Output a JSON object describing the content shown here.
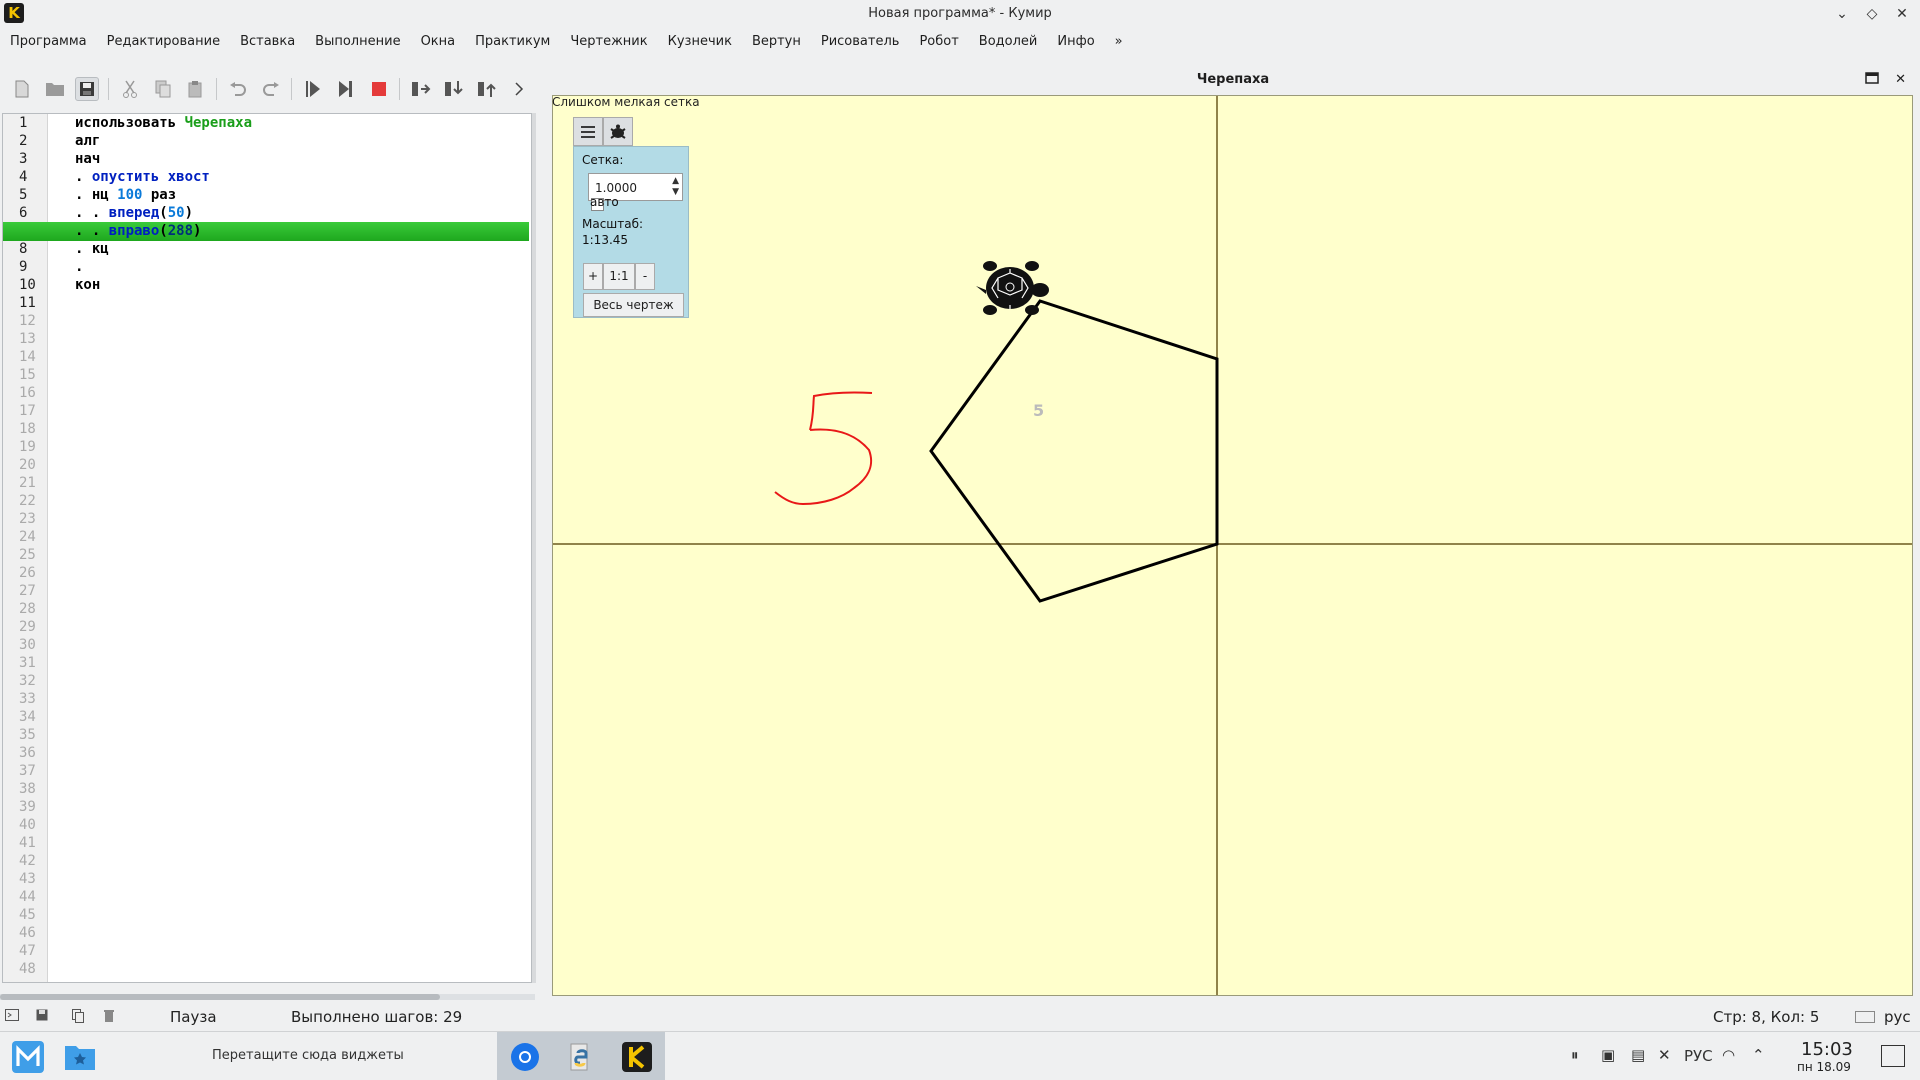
{
  "window": {
    "title": "Новая программа* - Кумир",
    "logo_letter": "K",
    "controls": [
      "⌄",
      "◇",
      "✕"
    ]
  },
  "menu": [
    "Программа",
    "Редактирование",
    "Вставка",
    "Выполнение",
    "Окна",
    "Практикум",
    "Чертежник",
    "Кузнечик",
    "Вертун",
    "Рисователь",
    "Робот",
    "Водолей",
    "Инфо",
    "»"
  ],
  "editor": {
    "line_count": 48,
    "current_line": 7,
    "lines": [
      [
        {
          "t": "использовать ",
          "c": "kw"
        },
        {
          "t": "Черепаха",
          "c": "grn"
        }
      ],
      [
        {
          "t": "алг",
          "c": "kw"
        }
      ],
      [
        {
          "t": "нач",
          "c": "kw"
        }
      ],
      [
        {
          "t": ". ",
          "c": "kw"
        },
        {
          "t": "опустить хвост",
          "c": "blu"
        }
      ],
      [
        {
          "t": ". нц ",
          "c": "kw"
        },
        {
          "t": "100",
          "c": "num"
        },
        {
          "t": " раз",
          "c": "kw"
        }
      ],
      [
        {
          "t": ". . ",
          "c": "kw"
        },
        {
          "t": "вперед",
          "c": "blu"
        },
        {
          "t": "(",
          "c": "kw"
        },
        {
          "t": "50",
          "c": "num"
        },
        {
          "t": ")",
          "c": "kw"
        }
      ],
      [
        {
          "t": ". . ",
          "c": "kw"
        },
        {
          "t": "вправо",
          "c": "blu"
        },
        {
          "t": "(",
          "c": "kw"
        },
        {
          "t": "288",
          "c": "num"
        },
        {
          "t": ")",
          "c": "kw"
        }
      ],
      [
        {
          "t": ". кц",
          "c": "kw"
        }
      ],
      [
        {
          "t": ".",
          "c": "kw"
        }
      ],
      [
        {
          "t": "кон",
          "c": "kw"
        }
      ]
    ]
  },
  "turtle_panel": {
    "title": "Черепаха",
    "grid_warning": "Слишком мелкая сетка",
    "grid_label": "Сетка:",
    "grid_value": "1.0000",
    "auto_label": "авто",
    "scale_label": "Масштаб:",
    "scale_value": "1:13.45",
    "zoom_in": "+",
    "zoom_reset": "1:1",
    "zoom_out": "-",
    "full_drawing": "Весь чертеж",
    "figure_label": "5",
    "handwritten": "5"
  },
  "status": {
    "state": "Пауза",
    "steps": "Выполнено шагов: 29",
    "position": "Стр: 8, Кол: 5",
    "lang": "рус"
  },
  "taskbar": {
    "widgets_hint": "Перетащите сюда виджеты",
    "kb_layout": "РУС",
    "time": "15:03",
    "date": "пн 18.09"
  },
  "colors": {
    "canvas": "#ffffcc",
    "highlight": "#2bb52b",
    "keyword_green": "#1a9e1a",
    "keyword_blue": "#0020c0",
    "number": "#0a7ad9"
  }
}
